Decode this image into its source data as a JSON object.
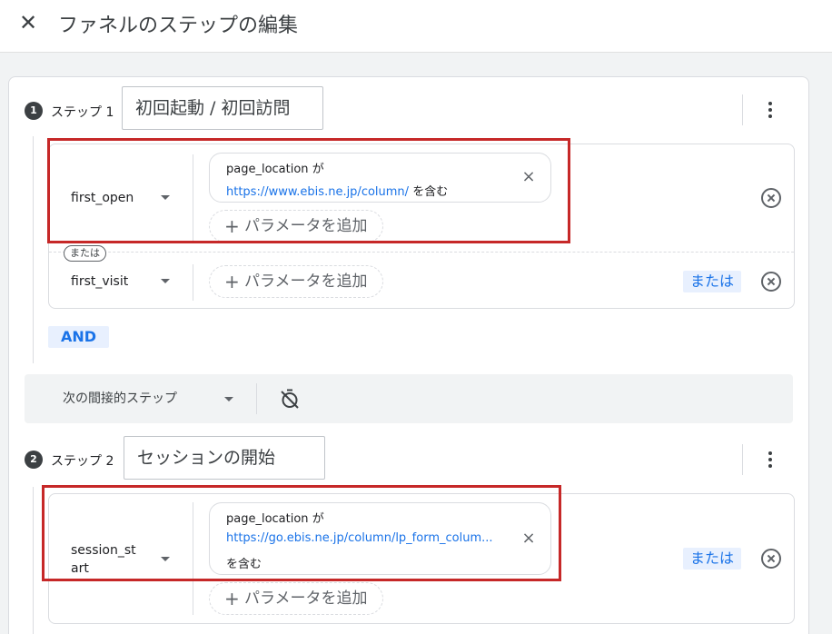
{
  "header": {
    "close_icon": "close-icon",
    "title": "ファネルのステップの編集"
  },
  "steps": [
    {
      "number": "1",
      "label": "ステップ 1",
      "name": "初回起動 / 初回訪問",
      "conditions": [
        {
          "event": "first_open",
          "param_name": "page_location",
          "param_op": "が",
          "param_value": "https://www.ebis.ne.jp/column/",
          "param_suffix": "を含む",
          "add_param_label": "パラメータを追加"
        },
        {
          "event": "first_visit",
          "add_param_label": "パラメータを追加",
          "or_label": "または"
        }
      ],
      "or_tag": "または",
      "and_label": "AND"
    },
    {
      "number": "2",
      "label": "ステップ 2",
      "name": "セッションの開始",
      "conditions": [
        {
          "event_line1": "session_st",
          "event_line2": "art",
          "param_name": "page_location",
          "param_op": "が",
          "param_value": "https://go.ebis.ne.jp/column/lp_form_colum...",
          "param_suffix": "を含む",
          "add_param_label": "パラメータを追加",
          "or_label": "または"
        }
      ]
    }
  ],
  "between": {
    "label": "次の間接的ステップ",
    "timer_icon": "timer-off-icon"
  },
  "colors": {
    "accent": "#1a73e8",
    "highlight": "#c62828",
    "chip_bg": "#e8f0fe"
  }
}
